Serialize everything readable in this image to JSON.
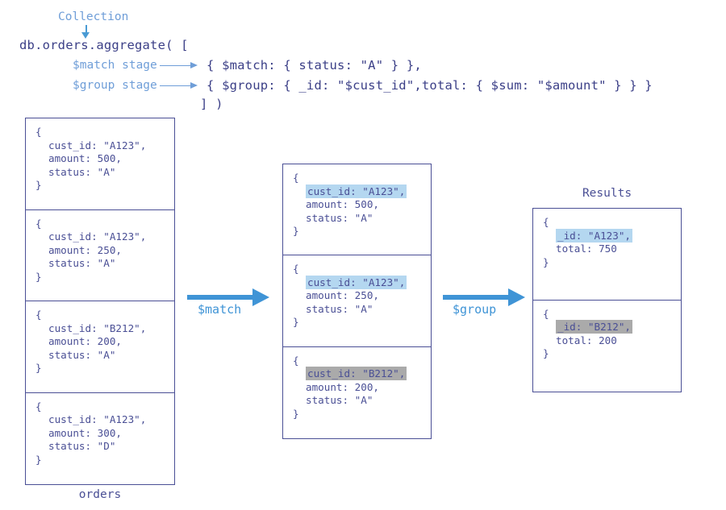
{
  "code": {
    "collection_label": "Collection",
    "call_line": "db.orders.aggregate( [",
    "match_line": "{ $match: { status: \"A\" } },",
    "group_line": "{ $group: { _id: \"$cust_id\",total: { $sum: \"$amount\" } } }",
    "close_line": "] )",
    "match_stage_label": "$match stage",
    "group_stage_label": "$group stage"
  },
  "colors": {
    "code_navy": "#3b3f87",
    "annotation_blue": "#6f9ed8",
    "arrow_blue": "#3f94d6",
    "box_border": "#4a4f95",
    "highlight_blue": "#b4d7f0",
    "highlight_gray": "#aaaaaa"
  },
  "orders": {
    "caption": "orders",
    "documents": [
      {
        "open": "{",
        "cust_id": "cust_id: \"A123\",",
        "amount": "amount: 500,",
        "status": "status: \"A\"",
        "close": "}"
      },
      {
        "open": "{",
        "cust_id": "cust_id: \"A123\",",
        "amount": "amount: 250,",
        "status": "status: \"A\"",
        "close": "}"
      },
      {
        "open": "{",
        "cust_id": "cust_id: \"B212\",",
        "amount": "amount: 200,",
        "status": "status: \"A\"",
        "close": "}"
      },
      {
        "open": "{",
        "cust_id": "cust_id: \"A123\",",
        "amount": "amount: 300,",
        "status": "status: \"D\"",
        "close": "}"
      }
    ]
  },
  "match_output": {
    "documents": [
      {
        "open": "{",
        "cust_id": "cust_id: \"A123\",",
        "highlight": "blue",
        "amount": "amount: 500,",
        "status": "status: \"A\"",
        "close": "}"
      },
      {
        "open": "{",
        "cust_id": "cust_id: \"A123\",",
        "highlight": "blue",
        "amount": "amount: 250,",
        "status": "status: \"A\"",
        "close": "}"
      },
      {
        "open": "{",
        "cust_id": "cust_id: \"B212\",",
        "highlight": "gray",
        "amount": "amount: 200,",
        "status": "status: \"A\"",
        "close": "}"
      }
    ]
  },
  "results": {
    "caption": "Results",
    "documents": [
      {
        "open": "{",
        "id": "_id: \"A123\",",
        "highlight": "blue",
        "total": "total: 750",
        "close": "}"
      },
      {
        "open": "{",
        "id": "_id: \"B212\",",
        "highlight": "gray",
        "total": "total: 200",
        "close": "}"
      }
    ]
  },
  "arrows": {
    "match_label": "$match",
    "group_label": "$group"
  }
}
